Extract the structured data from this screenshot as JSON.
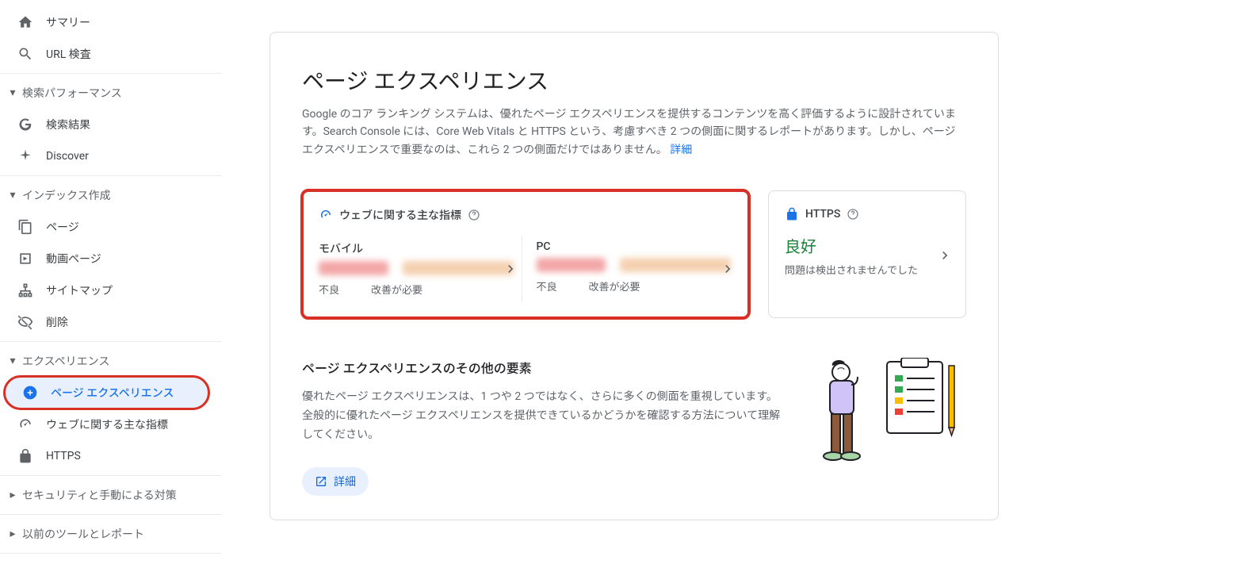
{
  "sidebar": {
    "items": [
      {
        "label": "サマリー"
      },
      {
        "label": "URL 検査"
      }
    ],
    "sections": [
      {
        "label": "検索パフォーマンス",
        "items": [
          {
            "label": "検索結果"
          },
          {
            "label": "Discover"
          }
        ]
      },
      {
        "label": "インデックス作成",
        "items": [
          {
            "label": "ページ"
          },
          {
            "label": "動画ページ"
          },
          {
            "label": "サイトマップ"
          },
          {
            "label": "削除"
          }
        ]
      },
      {
        "label": "エクスペリエンス",
        "items": [
          {
            "label": "ページ エクスペリエンス"
          },
          {
            "label": "ウェブに関する主な指標"
          },
          {
            "label": "HTTPS"
          }
        ]
      },
      {
        "label": "セキュリティと手動による対策",
        "collapsed": true
      },
      {
        "label": "以前のツールとレポート",
        "collapsed": true
      }
    ]
  },
  "main": {
    "title": "ページ エクスペリエンス",
    "description": "Google のコア ランキング システムは、優れたページ エクスペリエンスを提供するコンテンツを高く評価するように設計されています。Search Console には、Core Web Vitals と HTTPS という、考慮すべき 2 つの側面に関するレポートがあります。しかし、ページ エクスペリエンスで重要なのは、これら 2 つの側面だけではありません。",
    "learn_more_link": "詳細"
  },
  "cwv": {
    "title": "ウェブに関する主な指標",
    "mobile": {
      "label": "モバイル",
      "legend_bad": "不良",
      "legend_needs": "改善が必要"
    },
    "pc": {
      "label": "PC",
      "legend_bad": "不良",
      "legend_needs": "改善が必要"
    }
  },
  "https": {
    "title": "HTTPS",
    "status": "良好",
    "sub": "問題は検出されませんでした"
  },
  "other": {
    "title": "ページ エクスペリエンスのその他の要素",
    "desc": "優れたページ エクスペリエンスは、1 つや 2 つではなく、さらに多くの側面を重視しています。全般的に優れたページ エクスペリエンスを提供できているかどうかを確認する方法について理解してください。",
    "button": "詳細"
  }
}
